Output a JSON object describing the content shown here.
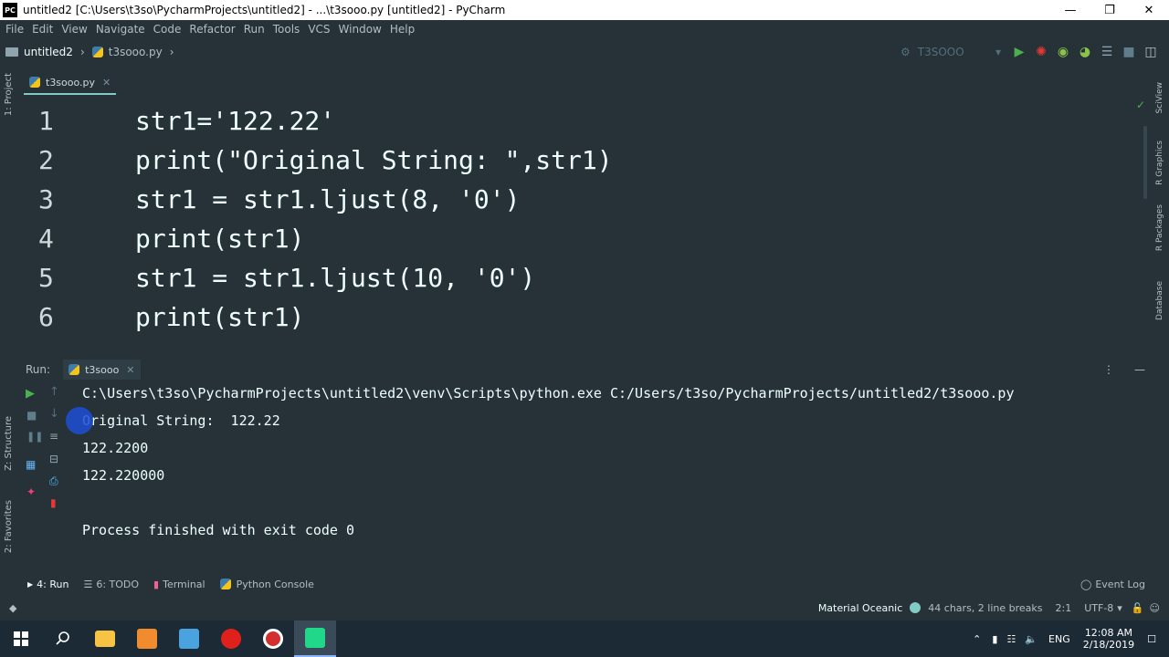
{
  "window": {
    "title": "untitled2 [C:\\Users\\t3so\\PycharmProjects\\untitled2] - ...\\t3sooo.py [untitled2] - PyCharm",
    "app_icon_text": "PC"
  },
  "menu": [
    "File",
    "Edit",
    "View",
    "Navigate",
    "Code",
    "Refactor",
    "Run",
    "Tools",
    "VCS",
    "Window",
    "Help"
  ],
  "breadcrumb": {
    "project": "untitled2",
    "file": "t3sooo.py"
  },
  "run_config": "T3SOOO",
  "left_strip": {
    "project": "1: Project",
    "structure": "Z: Structure",
    "favorites": "2: Favorites"
  },
  "right_strip": {
    "sciview": "SciView",
    "rgraphics": "R Graphics",
    "rpackages": "R Packages",
    "database": "Database"
  },
  "editor": {
    "tab_label": "t3sooo.py",
    "lines": [
      {
        "num": "1",
        "text": "str1='122.22'"
      },
      {
        "num": "2",
        "text": "print(\"Original String: \",str1)"
      },
      {
        "num": "3",
        "text": "str1 = str1.ljust(8, '0')"
      },
      {
        "num": "4",
        "text": "print(str1)"
      },
      {
        "num": "5",
        "text": "str1 = str1.ljust(10, '0')"
      },
      {
        "num": "6",
        "text": "print(str1)"
      }
    ]
  },
  "run": {
    "label": "Run:",
    "tab_label": "t3sooo",
    "output": [
      "C:\\Users\\t3so\\PycharmProjects\\untitled2\\venv\\Scripts\\python.exe C:/Users/t3so/PycharmProjects/untitled2/t3sooo.py",
      "Original String:  122.22",
      "122.2200",
      "122.220000",
      "",
      "Process finished with exit code 0"
    ]
  },
  "bottom_tabs": {
    "run": "4: Run",
    "todo": "6: TODO",
    "terminal": "Terminal",
    "python_console": "Python Console",
    "event_log": "Event Log"
  },
  "status": {
    "theme": "Material Oceanic",
    "selection": "44 chars, 2 line breaks",
    "position": "2:1",
    "encoding": "UTF-8"
  },
  "taskbar": {
    "lang": "ENG",
    "time": "12:08 AM",
    "date": "2/18/2019"
  },
  "colors": {
    "accent": "#80cbc4",
    "bg": "#263238",
    "string": "#c3e88d",
    "number": "#f78c6c",
    "function": "#82aaff"
  }
}
